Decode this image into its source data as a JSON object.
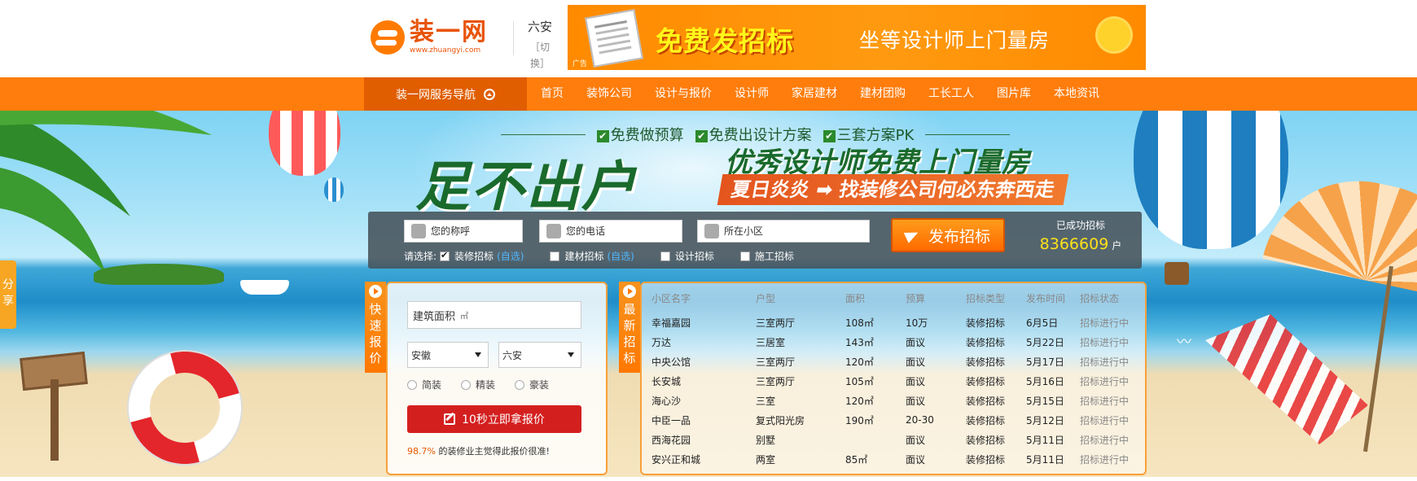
{
  "header": {
    "logo_cn": "装一网",
    "logo_en": "www.zhuangyi.com",
    "city": "六安",
    "city_switch": "［切换］",
    "ad": {
      "main": "免费发招标",
      "sub": "坐等设计师上门量房",
      "tag": "广告"
    }
  },
  "nav": {
    "service_label": "装一网服务导航",
    "items": [
      "首页",
      "装饰公司",
      "设计与报价",
      "设计师",
      "家居建材",
      "建材团购",
      "工长工人",
      "图片库",
      "本地资讯"
    ]
  },
  "banner": {
    "features": [
      "免费做预算",
      "免费出设计方案",
      "三套方案PK"
    ],
    "slogan_big": "足不出户",
    "slogan_right": "优秀设计师免费上门量房",
    "slogan_bar": "夏日炎炎 ➡ 找装修公司何必东奔西走"
  },
  "share_tab": "分享",
  "form": {
    "name_placeholder": "您的称呼",
    "phone_placeholder": "您的电话",
    "community_placeholder": "所在小区",
    "choose_label": "请选择:",
    "options": [
      {
        "label": "装修招标",
        "sub": "(自选)",
        "checked": true
      },
      {
        "label": "建材招标",
        "sub": "(自选)",
        "checked": false
      },
      {
        "label": "设计招标",
        "sub": "",
        "checked": false
      },
      {
        "label": "施工招标",
        "sub": "",
        "checked": false
      }
    ],
    "publish_label": "发布招标",
    "success_label": "已成功招标",
    "success_count": "8366609",
    "success_unit": "户"
  },
  "quick_quote": {
    "tab_chars": [
      "快",
      "速",
      "报",
      "价"
    ],
    "area_label": "建筑面积",
    "area_unit": "㎡",
    "province": "安徽",
    "city": "六安",
    "radios": [
      "简装",
      "精装",
      "豪装"
    ],
    "button_label": "10秒立即拿报价",
    "note_pct": "98.7%",
    "note_text": "的装修业主觉得此报价很准!"
  },
  "latest": {
    "tab_chars": [
      "最",
      "新",
      "招",
      "标"
    ],
    "columns": [
      "小区名字",
      "户型",
      "面积",
      "预算",
      "招标类型",
      "发布时间",
      "招标状态"
    ],
    "rows": [
      [
        "幸福嘉园",
        "三室两厅",
        "108㎡",
        "10万",
        "装修招标",
        "6月5日",
        "招标进行中"
      ],
      [
        "万达",
        "三居室",
        "143㎡",
        "面议",
        "装修招标",
        "5月22日",
        "招标进行中"
      ],
      [
        "中央公馆",
        "三室两厅",
        "120㎡",
        "面议",
        "装修招标",
        "5月17日",
        "招标进行中"
      ],
      [
        "长安城",
        "三室两厅",
        "105㎡",
        "面议",
        "装修招标",
        "5月16日",
        "招标进行中"
      ],
      [
        "海心沙",
        "三室",
        "120㎡",
        "面议",
        "装修招标",
        "5月15日",
        "招标进行中"
      ],
      [
        "中臣一品",
        "复式阳光房",
        "190㎡",
        "20-30",
        "装修招标",
        "5月12日",
        "招标进行中"
      ],
      [
        "西海花园",
        "别墅",
        "",
        "面议",
        "装修招标",
        "5月11日",
        "招标进行中"
      ],
      [
        "安兴正和城",
        "两室",
        "85㎡",
        "面议",
        "装修招标",
        "5月11日",
        "招标进行中"
      ]
    ]
  }
}
